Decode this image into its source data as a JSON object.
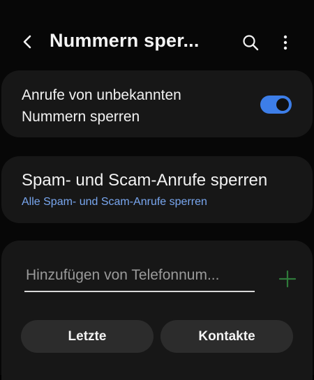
{
  "app_bar": {
    "title": "Nummern sper...",
    "back_icon": "chevron-left-icon",
    "search_icon": "search-icon",
    "more_icon": "more-vertical-icon"
  },
  "unknown_numbers": {
    "label": "Anrufe von unbekannten Nummern sperren",
    "toggle_on": true
  },
  "spam_calls": {
    "title": "Spam- und Scam-Anrufe sperren",
    "subtitle": "Alle Spam- und Scam-Anrufe sperren"
  },
  "add_number": {
    "placeholder": "Hinzufügen von Telefonnum...",
    "value": "",
    "add_icon": "plus-icon"
  },
  "buttons": {
    "recent": "Letzte",
    "contacts": "Kontakte"
  },
  "colors": {
    "accent": "#3d7ee8",
    "link": "#79a7f0",
    "add_icon": "#2f7a3a",
    "card": "#171717",
    "pill": "#2c2c2c"
  }
}
